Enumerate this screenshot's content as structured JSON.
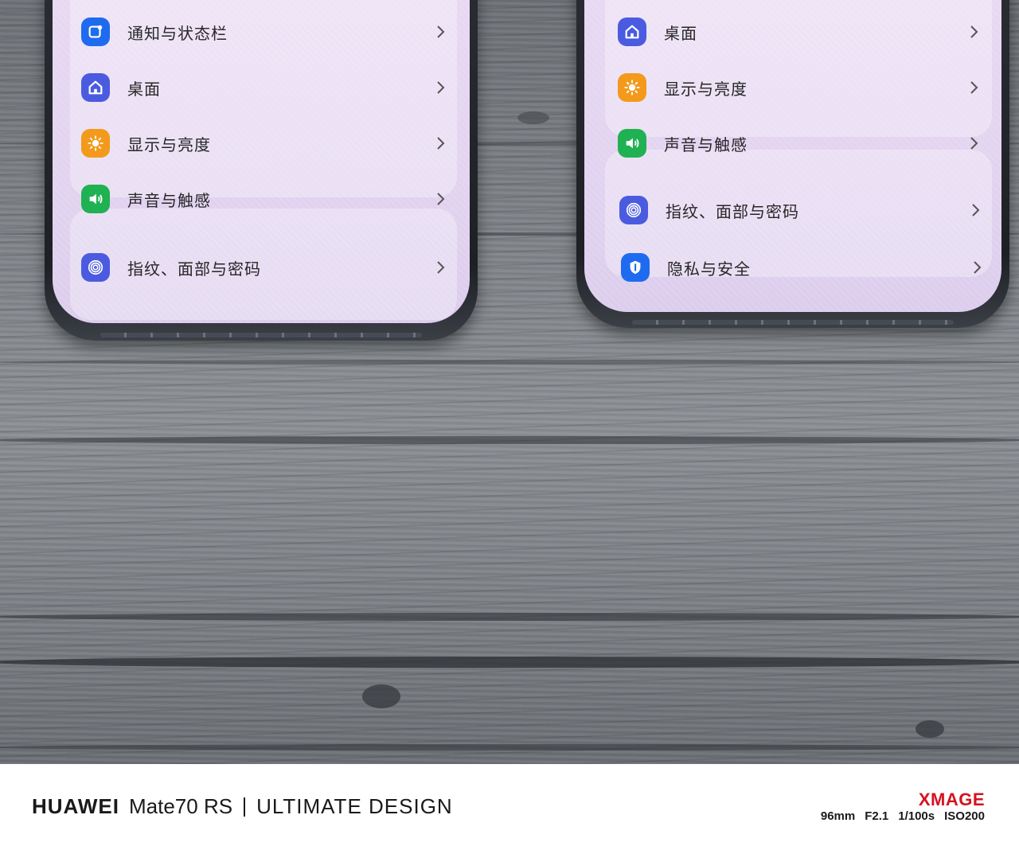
{
  "left_phone": {
    "rows": [
      {
        "label": "通知与状态栏",
        "icon": "notification-icon",
        "color": "#1e6bf0"
      },
      {
        "label": "桌面",
        "icon": "home-icon",
        "color": "#4b5be0"
      },
      {
        "label": "显示与亮度",
        "icon": "sun-icon",
        "color": "#f39a1c"
      },
      {
        "label": "声音与触感",
        "icon": "speaker-icon",
        "color": "#1fb152"
      },
      {
        "label": "指纹、面部与密码",
        "icon": "fingerprint-icon",
        "color": "#4b5be0"
      }
    ]
  },
  "right_phone": {
    "rows": [
      {
        "label": "桌面",
        "icon": "home-icon",
        "color": "#4b5be0"
      },
      {
        "label": "显示与亮度",
        "icon": "sun-icon",
        "color": "#f39a1c"
      },
      {
        "label": "声音与触感",
        "icon": "speaker-icon",
        "color": "#1fb152"
      },
      {
        "label": "指纹、面部与密码",
        "icon": "fingerprint-icon",
        "color": "#4b5be0"
      },
      {
        "label": "隐私与安全",
        "icon": "shield-icon",
        "color": "#1e6bf0"
      }
    ]
  },
  "footer": {
    "brand": "HUAWEI",
    "model": "Mate70 RS",
    "tagline": "ULTIMATE DESIGN",
    "xmage": "XMAGE",
    "focal": "96mm",
    "aperture": "F2.1",
    "shutter": "1/100s",
    "iso": "ISO200",
    "accent_color": "#d5131f"
  }
}
